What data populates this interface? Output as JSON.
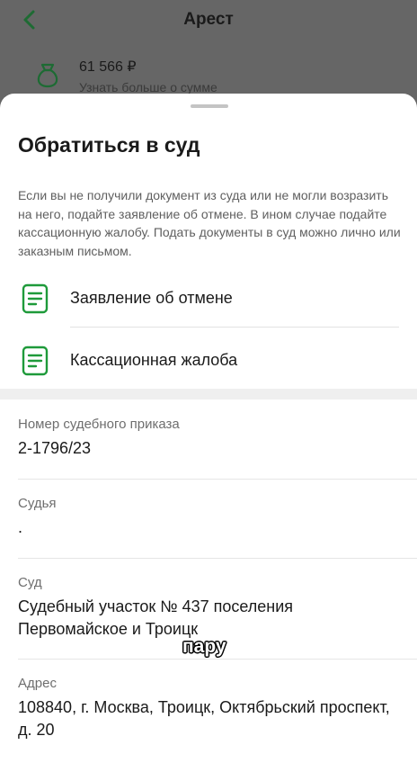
{
  "background": {
    "title": "Арест",
    "amount": "61 566 ₽",
    "amount_link": "Узнать больше о сумме",
    "icon": "money-bag-icon"
  },
  "sheet": {
    "title": "Обратиться в суд",
    "description": "Если вы не получили документ из суда или не могли возразить на него, подайте заявление об отмене. В ином случае подайте кассационную жалобу. Подать документы в суд можно лично или заказным письмом.",
    "documents": [
      {
        "label": "Заявление об отмене",
        "icon": "document-icon"
      },
      {
        "label": "Кассационная жалоба",
        "icon": "document-icon"
      }
    ],
    "fields": [
      {
        "label": "Номер судебного приказа",
        "value": "2-1796/23"
      },
      {
        "label": "Судья",
        "value": "."
      },
      {
        "label": "Суд",
        "value": "Судебный участок № 437 поселения Первомайское и Троицк"
      },
      {
        "label": "Адрес",
        "value": "108840, г. Москва, Троицк, Октябрьский проспект, д. 20"
      }
    ],
    "overlay_text": "пару"
  },
  "colors": {
    "accent_green": "#1e9a3a",
    "dim_background": "#666666"
  }
}
